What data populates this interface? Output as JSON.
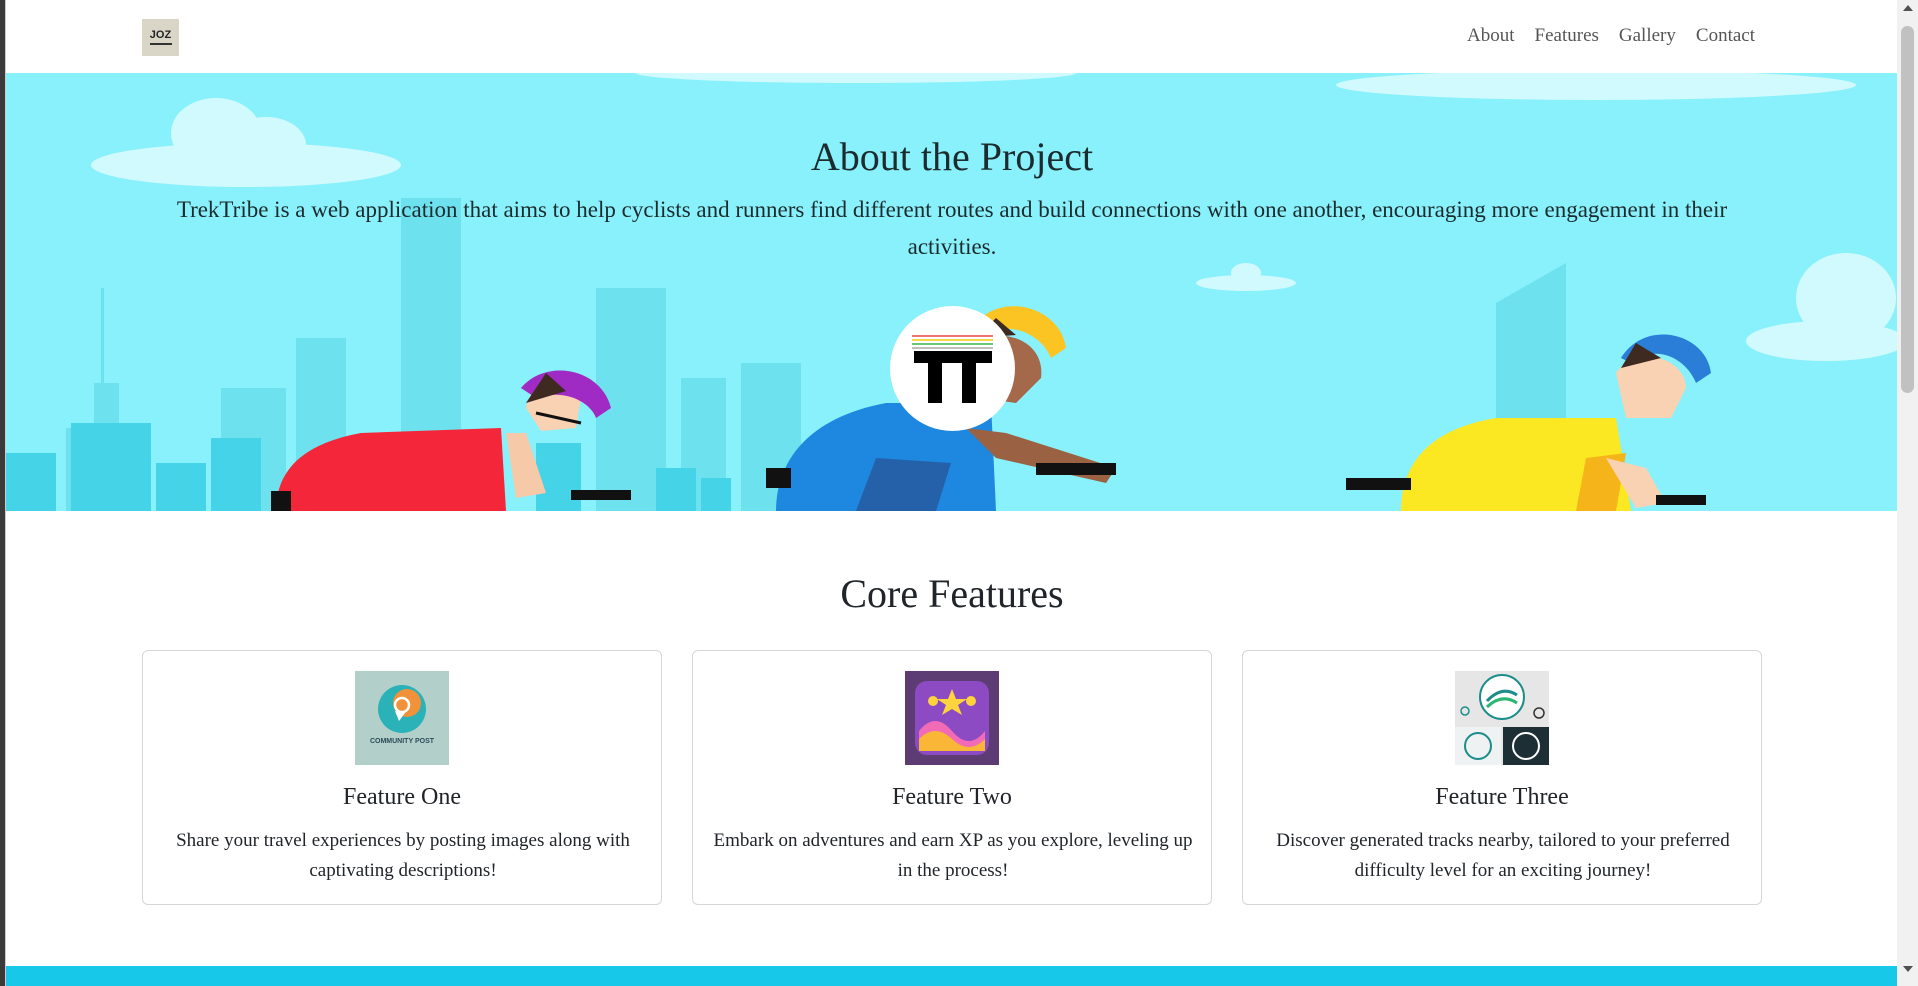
{
  "navbar": {
    "logo_text": "JOZ",
    "links": [
      "About",
      "Features",
      "Gallery",
      "Contact"
    ]
  },
  "hero": {
    "title": "About the Project",
    "description": "TrekTribe is a web application that aims to help cyclists and runners find different routes and build connections with one another, encouraging more engagement in their activities.",
    "center_logo_text": "TT"
  },
  "features": {
    "title": "Core Features",
    "cards": [
      {
        "title": "Feature One",
        "text": "Share your travel experiences by posting images along with captivating descriptions!",
        "image_caption": "COMMUNITY POST"
      },
      {
        "title": "Feature Two",
        "text": "Embark on adventures and earn XP as you explore, leveling up in the process!"
      },
      {
        "title": "Feature Three",
        "text": "Discover generated tracks nearby, tailored to your preferred difficulty level for an exciting journey!"
      }
    ]
  },
  "colors": {
    "hero_bg": "#88f1fb",
    "accent_strip": "#18c8e8",
    "cyclist_red": "#f4263a",
    "cyclist_blue": "#1e88e0",
    "cyclist_yellow": "#fbe822"
  }
}
